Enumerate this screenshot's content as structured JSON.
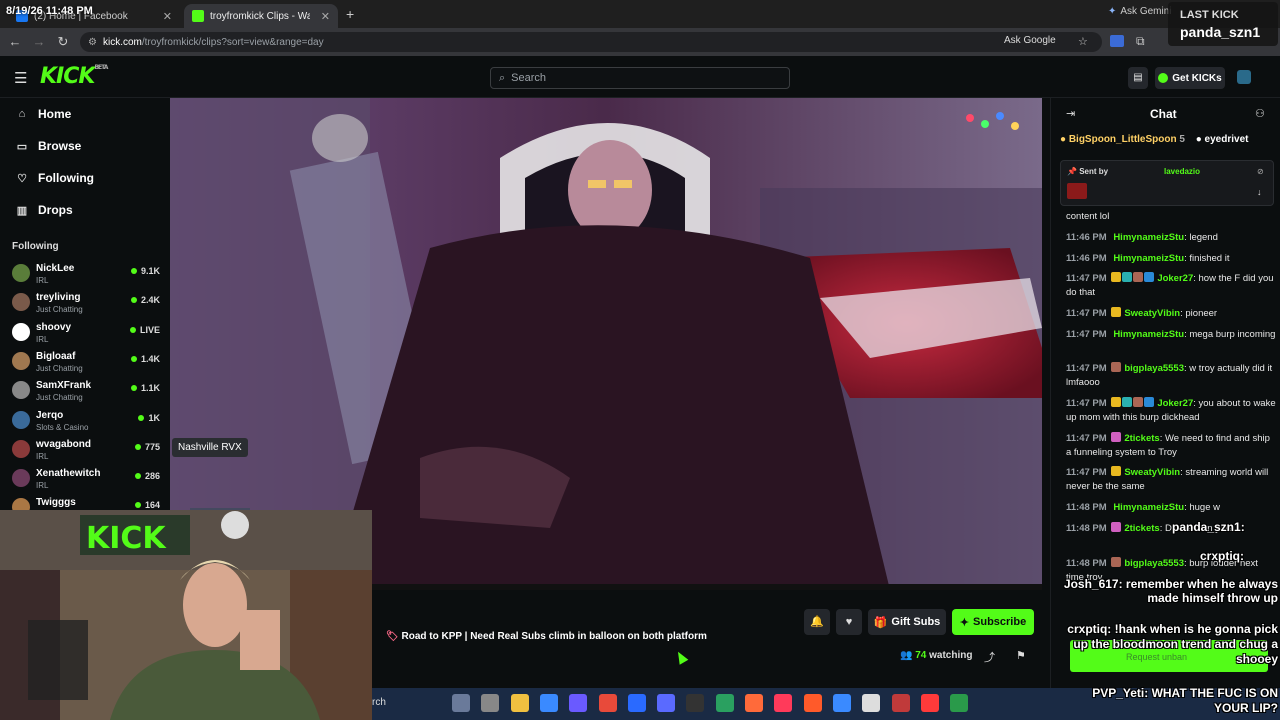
{
  "overlay_clock": "8/19/26 11:48 PM",
  "browser": {
    "tabs": [
      {
        "label": "(2) Home | Facebook",
        "close": "✕"
      },
      {
        "label": "troyfromkick Clips - Watch",
        "close": "✕"
      }
    ],
    "new_tab": "+",
    "url_host": "kick.com",
    "url_path": "/troyfromkick/clips?sort=view&range=day",
    "ask_google": "Ask Google",
    "ask_gemini": "Ask Gemini"
  },
  "last_kick": {
    "label": "LAST KICK",
    "user": "panda_szn1"
  },
  "header": {
    "logo": "KICK",
    "logo_sup": "BETA",
    "search_placeholder": "Search",
    "get_kicks": "Get KICKs"
  },
  "sidebar": {
    "nav": [
      {
        "label": "Home",
        "icon": "home-icon"
      },
      {
        "label": "Browse",
        "icon": "browse-icon"
      },
      {
        "label": "Following",
        "icon": "heart-icon"
      },
      {
        "label": "Drops",
        "icon": "drops-icon"
      }
    ],
    "following_header": "Following",
    "following": [
      {
        "name": "NickLee",
        "category": "IRL",
        "count": "9.1K",
        "avatar_color": "#5a7d3a"
      },
      {
        "name": "treyliving",
        "category": "Just Chatting",
        "count": "2.4K",
        "avatar_color": "#7a5a4a"
      },
      {
        "name": "shoovy",
        "category": "IRL",
        "count": "LIVE",
        "avatar_color": "#ffffff"
      },
      {
        "name": "Bigloaaf",
        "category": "Just Chatting",
        "count": "1.4K",
        "avatar_color": "#a07850"
      },
      {
        "name": "SamXFrank",
        "category": "Just Chatting",
        "count": "1.1K",
        "avatar_color": "#888888"
      },
      {
        "name": "Jerqo",
        "category": "Slots & Casino",
        "count": "1K",
        "avatar_color": "#3a6a9a"
      },
      {
        "name": "wvagabond",
        "category": "IRL",
        "count": "775",
        "avatar_color": "#8a3a3a"
      },
      {
        "name": "Xenathewitch",
        "category": "IRL",
        "count": "286",
        "avatar_color": "#6a3a5a"
      },
      {
        "name": "Twigggs",
        "category": "",
        "count": "164",
        "avatar_color": "#aa7744"
      }
    ]
  },
  "video": {
    "tooltip": "Nashville RVX"
  },
  "stream": {
    "title": "Road to KPP | Need Real Subs climb in balloon on both platform",
    "gift_subs": "Gift Subs",
    "subscribe": "Subscribe",
    "watching_count": "74",
    "watching_label": "watching"
  },
  "chat": {
    "title": "Chat",
    "gifters": [
      {
        "name": "BigSpoon_LittleSpoon",
        "count": "5"
      },
      {
        "name": "eyedrivet"
      }
    ],
    "pinned": {
      "sent_by_label": "Sent by",
      "user": "lavedazio"
    },
    "messages": [
      {
        "time": "",
        "user": "",
        "text": "content lol",
        "color": "#e8e8e8",
        "badges": []
      },
      {
        "time": "11:46 PM",
        "user": "HimynameizStu",
        "text": "legend",
        "color": "#53fc18",
        "badges": []
      },
      {
        "time": "11:46 PM",
        "user": "HimynameizStu",
        "text": "finished it",
        "color": "#53fc18",
        "badges": []
      },
      {
        "time": "11:47 PM",
        "user": "Joker27",
        "text": "how the F did you do that",
        "color": "#53fc18",
        "badges": [
          "#e8b820",
          "#2ab0b0",
          "#aa6655",
          "#2a8ad8"
        ]
      },
      {
        "time": "11:47 PM",
        "user": "SweatyVibin",
        "text": "pioneer",
        "color": "#53fc18",
        "badges": [
          "#e8b820"
        ]
      },
      {
        "time": "11:47 PM",
        "user": "HimynameizStu",
        "text": "mega burp incoming",
        "color": "#53fc18",
        "badges": []
      },
      {
        "time": "11:47 PM",
        "user": "bigplaya5553",
        "text": "w troy actually did it lmfaooo",
        "color": "#53fc18",
        "badges": [
          "#aa6655"
        ]
      },
      {
        "time": "11:47 PM",
        "user": "Joker27",
        "text": "you about to wake up mom with this burp dickhead",
        "color": "#53fc18",
        "badges": [
          "#e8b820",
          "#2ab0b0",
          "#aa6655",
          "#2a8ad8"
        ]
      },
      {
        "time": "11:47 PM",
        "user": "2tickets",
        "text": "We need to find and ship a funneling system to Troy",
        "color": "#53fc18",
        "badges": [
          "#d060c0"
        ]
      },
      {
        "time": "11:47 PM",
        "user": "SweatyVibin",
        "text": "streaming world will never be the same",
        "color": "#53fc18",
        "badges": [
          "#e8b820"
        ]
      },
      {
        "time": "11:48 PM",
        "user": "HimynameizStu",
        "text": "huge w",
        "color": "#53fc18",
        "badges": []
      },
      {
        "time": "11:48 PM",
        "user": "2tickets",
        "text": "Did balloon yet?",
        "color": "#53fc18",
        "badges": [
          "#d060c0"
        ]
      },
      {
        "time": "11:48 PM",
        "user": "bigplaya5553",
        "text": "burp louder next time troy",
        "color": "#53fc18",
        "badges": [
          "#aa6655"
        ]
      }
    ]
  },
  "overlays": {
    "panda": "panda_szn1:",
    "crxptiq1": "crxptiq:",
    "josh": "Josh_617: remember when he always made himself throw up",
    "crxptiq2": "crxptiq: !hank when is he gonna pick up the bloodmoon trend and chug a shooey",
    "green_bar": "Request unban",
    "pvp": "PVP_Yeti: WHAT THE FUC IS ON YOUR LIP?"
  },
  "taskbar": {
    "search_fragment": "rch"
  },
  "colors": {
    "accent": "#53fc18",
    "bg": "#0b0e0f",
    "panel": "#24272c"
  }
}
